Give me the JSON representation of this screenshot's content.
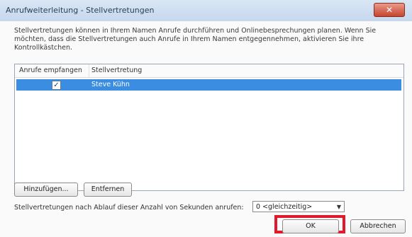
{
  "window": {
    "title": "Anrufweiterleitung - Stellvertretungen",
    "close_label": "✕"
  },
  "description": "Stellvertretungen können in Ihrem Namen Anrufe durchführen und Onlinebesprechungen planen. Wenn Sie möchten, dass die Stellvertretungen auch Anrufe in Ihrem Namen entgegennehmen, aktivieren Sie ihre Kontrollkästchen.",
  "list": {
    "columns": [
      "Anrufe empfangen",
      "Stellvertretung"
    ],
    "rows": [
      {
        "receive_calls": true,
        "delegate": "Steve Kühn",
        "selected": true
      }
    ]
  },
  "buttons": {
    "add": "Hinzufügen...",
    "remove": "Entfernen",
    "ok": "OK",
    "cancel": "Abbrechen"
  },
  "seconds": {
    "label": "Stellvertretungen nach Ablauf dieser Anzahl von Sekunden anrufen:",
    "selected_value": "0 <gleichzeitig>"
  },
  "colors": {
    "selection": "#3a8de0",
    "highlight_frame": "#e0192b"
  }
}
